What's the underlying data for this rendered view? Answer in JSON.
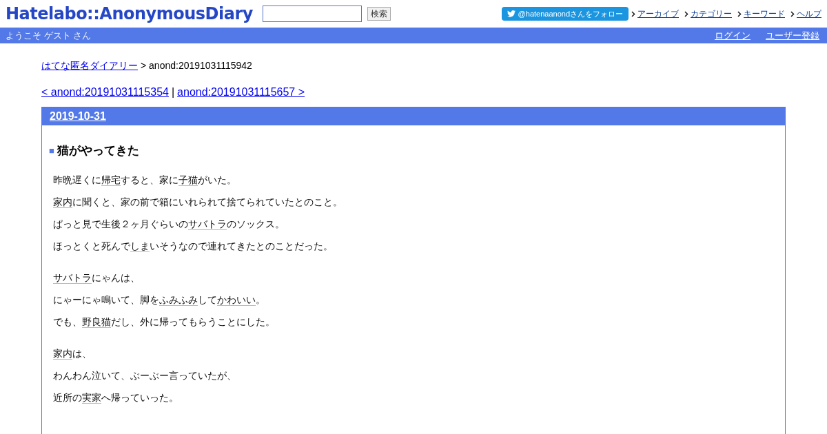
{
  "header": {
    "logo": "Hatelabo::AnonymousDiary",
    "search": {
      "button": "検索"
    },
    "follow_button": "@hatenaanondさんをフォロー",
    "nav_links": [
      "アーカイブ",
      "カテゴリー",
      "キーワード",
      "ヘルプ"
    ]
  },
  "user_bar": {
    "welcome": "ようこそ ゲスト さん",
    "links": [
      "ログイン",
      "ユーザー登録"
    ]
  },
  "breadcrumb": {
    "link": "はてな匿名ダイアリー",
    "current": "> anond:20191031115942"
  },
  "pager": {
    "prev": "< anond:20191031115354",
    "separator": "|",
    "next": "anond:20191031115657 >"
  },
  "day": {
    "date": "2019-10-31",
    "title_mark": "■",
    "title": "猫がやってきた",
    "groups": [
      [
        [
          {
            "kind": "text",
            "text": "昨晩遅くに"
          },
          {
            "kind": "keyword",
            "text": "帰宅"
          },
          {
            "kind": "text",
            "text": "すると、家に"
          },
          {
            "kind": "keyword",
            "text": "子猫"
          },
          {
            "kind": "text",
            "text": "がいた。"
          }
        ],
        [
          {
            "kind": "keyword",
            "text": "家内"
          },
          {
            "kind": "text",
            "text": "に聞くと、家の前で箱にいれられて捨てられていたとのこと。"
          }
        ],
        [
          {
            "kind": "text",
            "text": "ぱっと見で生後２ヶ月ぐらいの"
          },
          {
            "kind": "keyword",
            "text": "サバトラ"
          },
          {
            "kind": "text",
            "text": "のソックス。"
          }
        ],
        [
          {
            "kind": "text",
            "text": "ほっとくと死んで"
          },
          {
            "kind": "keyword",
            "text": "しま"
          },
          {
            "kind": "text",
            "text": "いそうなので連れてきたとのことだった。"
          }
        ]
      ],
      [
        [
          {
            "kind": "keyword",
            "text": "サバトラ"
          },
          {
            "kind": "text",
            "text": "にゃんは、"
          }
        ],
        [
          {
            "kind": "text",
            "text": "にゃーにゃ鳴いて、脚を"
          },
          {
            "kind": "keyword",
            "text": "ふみふみ"
          },
          {
            "kind": "text",
            "text": "して"
          },
          {
            "kind": "keyword",
            "text": "かわいい"
          },
          {
            "kind": "text",
            "text": "。"
          }
        ],
        [
          {
            "kind": "text",
            "text": "でも、"
          },
          {
            "kind": "keyword",
            "text": "野良猫"
          },
          {
            "kind": "text",
            "text": "だし、外に帰ってもらうことにした。"
          }
        ]
      ],
      [
        [
          {
            "kind": "keyword",
            "text": "家内"
          },
          {
            "kind": "text",
            "text": "は、"
          }
        ],
        [
          {
            "kind": "text",
            "text": "わんわん泣いて、ぶーぶー言っていたが、"
          }
        ],
        [
          {
            "kind": "text",
            "text": "近所の"
          },
          {
            "kind": "keyword",
            "text": "実家"
          },
          {
            "kind": "text",
            "text": "へ帰っていった。"
          }
        ]
      ]
    ]
  }
}
